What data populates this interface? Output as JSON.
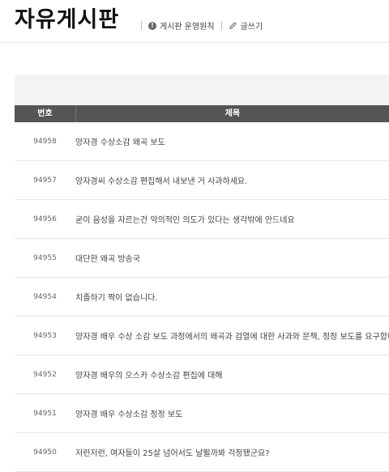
{
  "page": {
    "title": "자유게시판",
    "links": [
      {
        "icon": "info-icon",
        "label": "게시판 운영원칙"
      },
      {
        "icon": "pencil-icon",
        "label": "글쓰기"
      }
    ]
  },
  "table": {
    "columns": {
      "number": "번호",
      "title": "제목"
    },
    "rows": [
      {
        "number": "94958",
        "title": "양자경 수상소감 왜곡 보도"
      },
      {
        "number": "94957",
        "title": "양자경씨 수상소감 편집해서 내보낸 거 사과하세요."
      },
      {
        "number": "94956",
        "title": "굳이 음성을 자르는건 악의적인 의도가 있다는 생각밖에 안드네요"
      },
      {
        "number": "94955",
        "title": "대단한 왜곡 방송국"
      },
      {
        "number": "94954",
        "title": "치졸하기 짝이 없습니다."
      },
      {
        "number": "94953",
        "title": "양자경 배우 수상 소감 보도 과정에서의 왜곡과 검열에 대한 사과와 문책, 정정 보도를 요구합니다"
      },
      {
        "number": "94952",
        "title": "양자경 배우의 오스카 수상소감 편집에 대해"
      },
      {
        "number": "94951",
        "title": "양자경 배우 수상소감 정정 보도"
      },
      {
        "number": "94950",
        "title": "저런저런, 여자들이 25살 넘어서도 날뛸까봐 걱정됐군요?"
      }
    ]
  }
}
